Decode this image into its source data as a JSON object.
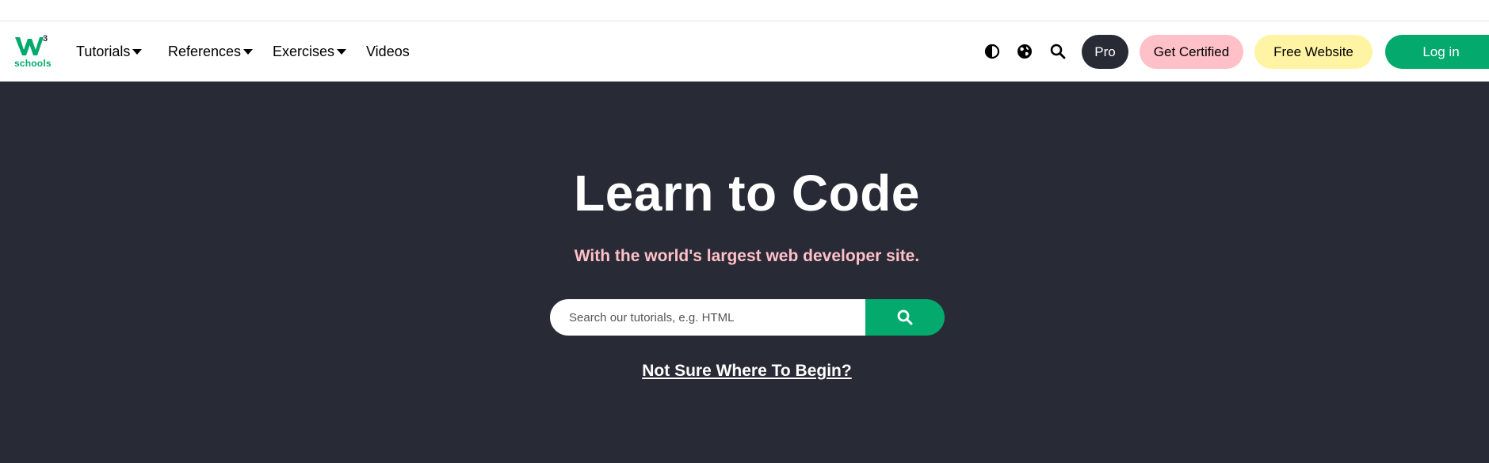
{
  "logo": {
    "text": "schools",
    "superscript": "3",
    "color": "#04AA6D"
  },
  "nav": {
    "tutorials": "Tutorials",
    "references": "References",
    "exercises": "Exercises",
    "videos": "Videos"
  },
  "actions": {
    "pro": "Pro",
    "get_certified": "Get Certified",
    "free_website": "Free Website",
    "login": "Log in"
  },
  "icons": [
    "contrast-icon",
    "globe-icon",
    "search-icon"
  ],
  "hero": {
    "title": "Learn to Code",
    "subtitle": "With the world's largest web developer site.",
    "search_placeholder": "Search our tutorials, e.g. HTML",
    "begin_link": "Not Sure Where To Begin?"
  },
  "colors": {
    "accent_green": "#04AA6D",
    "dark_bg": "#282A35",
    "pink": "#FFC0C7",
    "yellow": "#FFF4A3"
  }
}
